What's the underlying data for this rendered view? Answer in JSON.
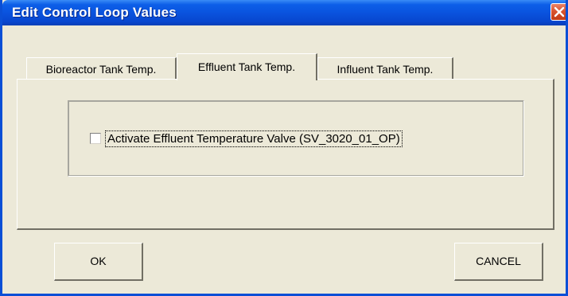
{
  "window": {
    "title": "Edit Control Loop Values",
    "close_icon": "close-icon"
  },
  "tabs": [
    {
      "label": "Bioreactor Tank Temp.",
      "active": false
    },
    {
      "label": "Effluent Tank Temp.",
      "active": true
    },
    {
      "label": "Influent Tank Temp.",
      "active": false
    }
  ],
  "panel": {
    "checkbox_label": "Activate Effluent Temperature Valve (SV_3020_01_OP)",
    "checkbox_checked": false
  },
  "buttons": {
    "ok_label": "OK",
    "cancel_label": "CANCEL"
  },
  "colors": {
    "titlebar": "#0a55e0",
    "close_button": "#d9532e",
    "dialog_background": "#ece9d8"
  }
}
